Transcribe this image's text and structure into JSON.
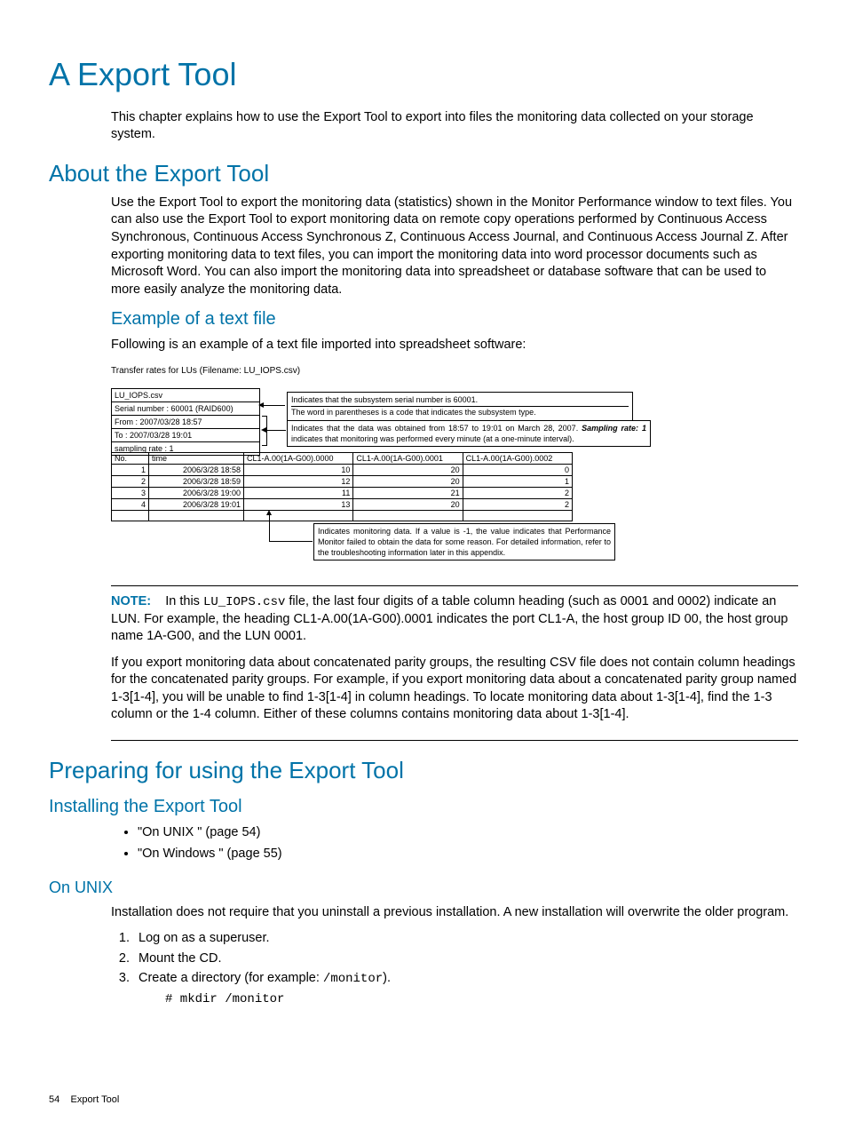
{
  "page": {
    "title": "A Export Tool",
    "intro": "This chapter explains how to use the Export Tool to export into files the monitoring data collected on your storage system.",
    "footer_page": "54",
    "footer_label": "Export Tool"
  },
  "about": {
    "heading": "About the Export Tool",
    "body": "Use the Export Tool to export the monitoring data (statistics) shown in the Monitor Performance window to text files. You can also use the Export Tool to export monitoring data on remote copy operations performed by Continuous Access Synchronous, Continuous Access Synchronous Z, Continuous Access Journal, and Continuous Access Journal Z. After exporting monitoring data to text files, you can import the monitoring data into word processor documents such as Microsoft Word. You can also import the monitoring data into spreadsheet or database software that can be used to more easily analyze the monitoring data."
  },
  "example": {
    "heading": "Example of a text file",
    "intro": "Following is an example of a text file imported into spreadsheet software:",
    "caption": "Transfer rates for LUs (Filename: LU_IOPS.csv)",
    "meta": {
      "filename": "LU_IOPS.csv",
      "serial": "Serial number : 60001 (RAID600)",
      "from": "From : 2007/03/28 18:57",
      "to": "To     : 2007/03/28 19:01",
      "sampling": "sampling rate : 1"
    },
    "callout1_line1": "Indicates that the subsystem serial number is 60001.",
    "callout1_line2": "The word in parentheses is a code that indicates the subsystem type.",
    "callout2_a": "Indicates that the data was obtained from 18:57 to 19:01 on March 28, 2007. ",
    "callout2_b": "Sampling rate: 1",
    "callout2_c": " indicates that monitoring was performed every minute (at a one-minute interval).",
    "callout3": "Indicates monitoring data. If a value is -1, the value indicates that Performance Monitor failed to obtain the data for some reason. For detailed information, refer to the troubleshooting information later in this appendix.",
    "table": {
      "headers": [
        "No.",
        "time",
        "CL1-A.00(1A-G00).0000",
        "CL1-A.00(1A-G00).0001",
        "CL1-A.00(1A-G00).0002"
      ],
      "rows": [
        [
          "1",
          "2006/3/28 18:58",
          "10",
          "20",
          "0"
        ],
        [
          "2",
          "2006/3/28 18:59",
          "12",
          "20",
          "1"
        ],
        [
          "3",
          "2006/3/28 19:00",
          "11",
          "21",
          "2"
        ],
        [
          "4",
          "2006/3/28 19:01",
          "13",
          "20",
          "2"
        ]
      ]
    }
  },
  "note": {
    "label": "NOTE:",
    "text1a": "In this ",
    "code1": "LU_IOPS.csv",
    "text1b": " file, the last four digits of a table column heading (such as 0001 and 0002) indicate an LUN. For example, the heading CL1-A.00(1A-G00).0001 indicates the port CL1-A, the host group ID 00, the host group name 1A-G00, and the LUN 0001.",
    "text2": "If you export monitoring data about concatenated parity groups, the resulting CSV file does not contain column headings for the concatenated parity groups. For example, if you export monitoring data about a concatenated parity group named 1-3[1-4], you will be unable to find 1-3[1-4] in column headings. To locate monitoring data about 1-3[1-4], find the 1-3 column or the 1-4 column. Either of these columns contains monitoring data about 1-3[1-4]."
  },
  "preparing": {
    "heading": "Preparing for using the Export Tool",
    "installing": "Installing the Export Tool",
    "link1": "\"On UNIX \" (page 54)",
    "link2": "\"On Windows \" (page 55)",
    "unix_heading": "On UNIX",
    "unix_intro": "Installation does not require that you uninstall a previous installation. A new installation will overwrite the older program.",
    "step1": "Log on as a superuser.",
    "step2": "Mount the CD.",
    "step3a": "Create a directory (for example: ",
    "step3_code": "/monitor",
    "step3b": ").",
    "cmd": "# mkdir /monitor"
  }
}
